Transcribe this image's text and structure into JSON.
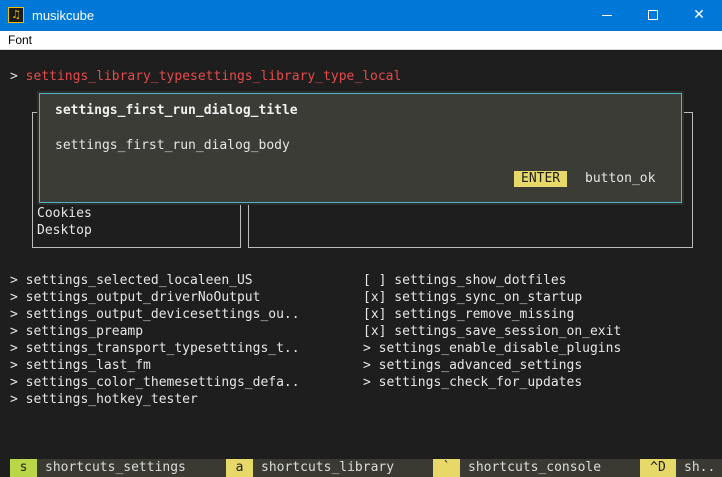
{
  "window": {
    "title": "musikcube",
    "icon": "music-note-icon",
    "app_glyph": "♫",
    "close_glyph": "✕"
  },
  "menu": {
    "font": "Font"
  },
  "library": {
    "marker": ">",
    "label": "settings_library_typesettings_library_type_local"
  },
  "browser": {
    "visible_items": [
      "Cookies",
      "Desktop"
    ]
  },
  "dialog": {
    "title": "settings_first_run_dialog_title",
    "body": "settings_first_run_dialog_body",
    "enter_key": "ENTER",
    "button_ok": "button_ok"
  },
  "settings_left": [
    "> settings_selected_localeen_US",
    "> settings_output_driverNoOutput",
    "> settings_output_devicesettings_ou..",
    "> settings_preamp",
    "> settings_transport_typesettings_t..",
    "> settings_last_fm",
    "> settings_color_themesettings_defa..",
    "> settings_hotkey_tester"
  ],
  "settings_right": [
    "[ ] settings_show_dotfiles",
    "[x] settings_sync_on_startup",
    "[x] settings_remove_missing",
    "[x] settings_save_session_on_exit",
    "> settings_enable_disable_plugins",
    "> settings_advanced_settings",
    "> settings_check_for_updates"
  ],
  "shortcuts": [
    {
      "key": "s",
      "label": "shortcuts_settings"
    },
    {
      "key": "a",
      "label": "shortcuts_library"
    },
    {
      "key": "`",
      "label": "shortcuts_console"
    },
    {
      "key": "^D",
      "label": "sh.."
    }
  ],
  "colors": {
    "titlebar": "#0078d7",
    "accent_red": "#e54b4b",
    "dialog_border": "#4fb6c6",
    "key_green": "#b9d548",
    "key_yellow": "#e6d96a"
  }
}
